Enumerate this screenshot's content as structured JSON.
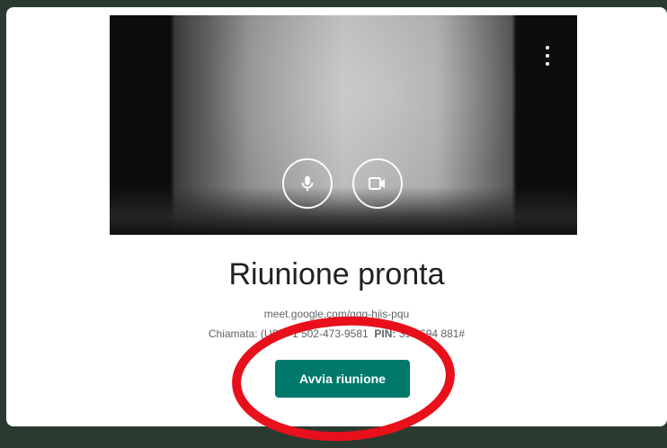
{
  "video_preview": {
    "more_icon": "more-vert-icon",
    "mic_icon": "microphone-icon",
    "camera_icon": "video-camera-icon"
  },
  "meeting": {
    "title": "Riunione pronta",
    "link": "meet.google.com/ggg-hjis-pqu",
    "dial_label": "Chiamata:",
    "dial_region": "(US)",
    "dial_number": "+1 502-473-9581",
    "pin_label": "PIN:",
    "pin_value": "394 694 881#",
    "start_button_label": "Avvia riunione"
  },
  "colors": {
    "background": "#2b3a31",
    "accent": "#00796b",
    "annotation": "#e8101a"
  }
}
